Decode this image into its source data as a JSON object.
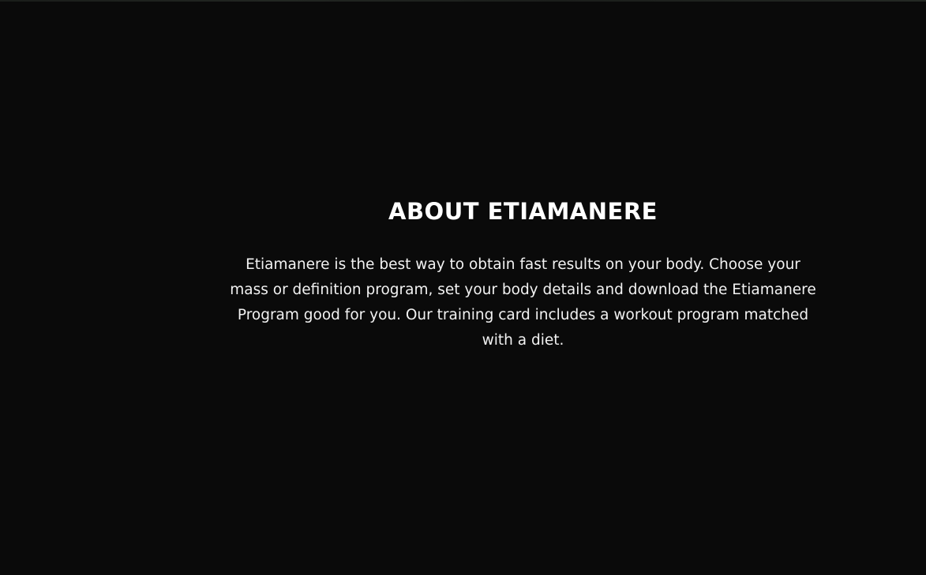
{
  "about": {
    "title": "ABOUT ETIAMANERE",
    "description": "Etiamanere is the best way to obtain fast results on your body. Choose your mass or definition program, set your body details and download the Etiamanere Program good for you. Our training card includes a workout program matched with a diet."
  },
  "colors": {
    "background": "#0a0a0a",
    "text": "#ffffff"
  }
}
